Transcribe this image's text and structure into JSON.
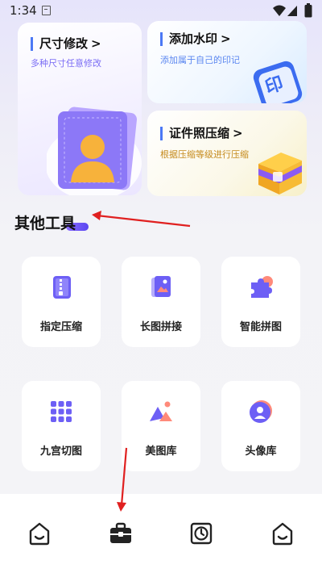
{
  "status_bar": {
    "time": "1:34"
  },
  "feature_cards": {
    "resize": {
      "title": "尺寸修改",
      "subtitle": "多种尺寸任意修改",
      "chevron": ">"
    },
    "watermark": {
      "title": "添加水印",
      "subtitle": "添加属于自己的印记",
      "chevron": ">",
      "badge_text": "印"
    },
    "idphoto": {
      "title": "证件照压缩",
      "subtitle": "根据压缩等级进行压缩",
      "chevron": ">"
    }
  },
  "other_tools": {
    "title": "其他工具",
    "items": [
      {
        "label": "指定压缩",
        "icon": "zip-file-icon"
      },
      {
        "label": "长图拼接",
        "icon": "image-stack-icon"
      },
      {
        "label": "智能拼图",
        "icon": "puzzle-icon"
      },
      {
        "label": "九宫切图",
        "icon": "grid-nine-icon"
      },
      {
        "label": "美图库",
        "icon": "landscape-icon"
      },
      {
        "label": "头像库",
        "icon": "avatar-icon"
      }
    ]
  },
  "bottom_nav": {
    "items": [
      {
        "icon": "home-icon"
      },
      {
        "icon": "toolbox-icon"
      },
      {
        "icon": "clock-icon"
      },
      {
        "icon": "profile-icon"
      }
    ]
  },
  "colors": {
    "accent": "#5b4ef0",
    "watermark_accent": "#5a86f0",
    "idphoto_accent": "#c58a1c",
    "annotation_arrow": "#e02020"
  }
}
